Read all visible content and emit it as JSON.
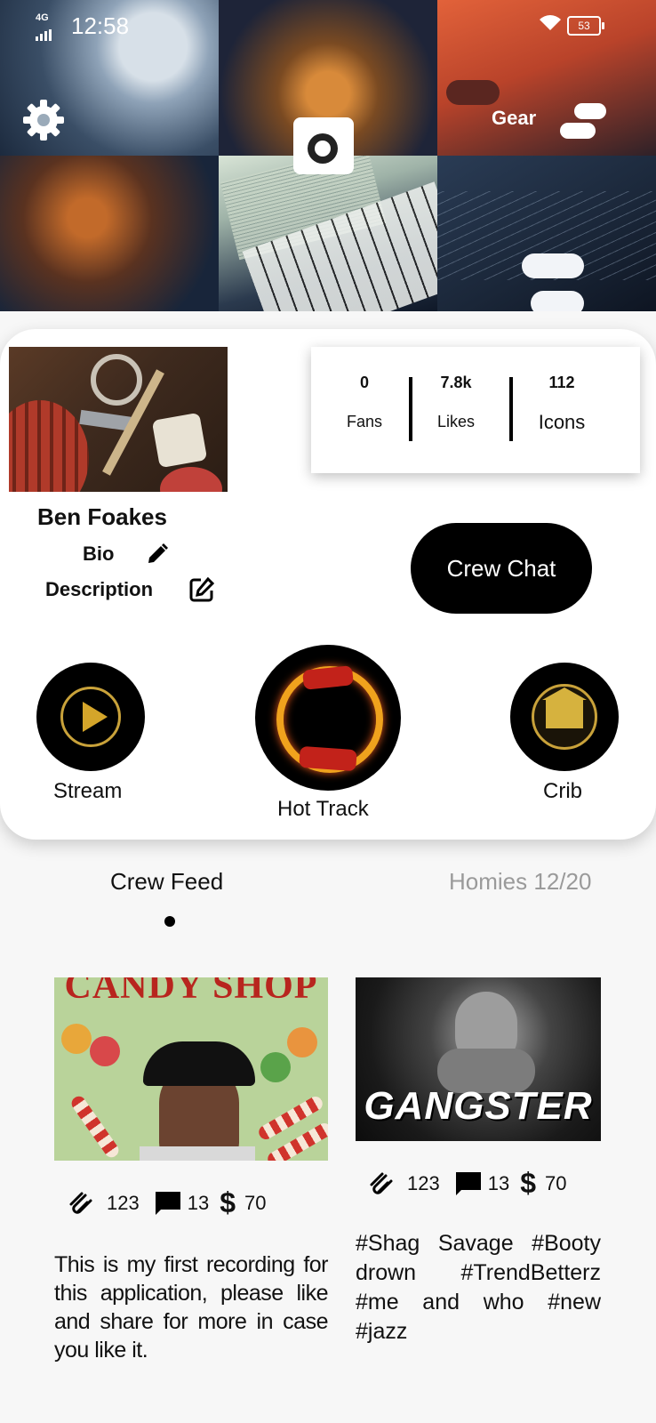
{
  "status_bar": {
    "network": "4G",
    "time": "12:58",
    "battery": "53"
  },
  "header": {
    "gear_label": "Gear"
  },
  "profile": {
    "name": "Ben Foakes",
    "bio_label": "Bio",
    "description_label": "Description",
    "crew_chat_label": "Crew Chat",
    "stats": [
      {
        "value": "0",
        "label": "Fans"
      },
      {
        "value": "7.8k",
        "label": "Likes"
      },
      {
        "value": "112",
        "label": "Icons"
      }
    ],
    "shortcuts": {
      "stream": "Stream",
      "hot_track": "Hot Track",
      "crib": "Crib"
    }
  },
  "feed": {
    "tabs": {
      "crew_feed": "Crew Feed",
      "homies": "Homies 12/20"
    },
    "posts": [
      {
        "image_title": "CANDY SHOP",
        "clips": "123",
        "comments": "13",
        "dollars": "70",
        "text": "This is my first recording for this application, please like and share for more in case you like it."
      },
      {
        "image_title": "GANGSTER",
        "clips": "123",
        "comments": "13",
        "dollars": "70",
        "text": "#Shag Savage #Booty drown #TrendBetterz #me and who #new #jazz"
      }
    ]
  },
  "colors": {
    "accent": "#000000",
    "gold": "#d4a52a",
    "muted_tab": "#9a9a9a"
  },
  "icons": [
    "settings-gear-icon",
    "camera-icon",
    "toggle-icon",
    "pencil-icon",
    "edit-square-icon",
    "play-icon",
    "house-icon",
    "paperclip-icon",
    "comment-icon",
    "dollar-icon"
  ]
}
